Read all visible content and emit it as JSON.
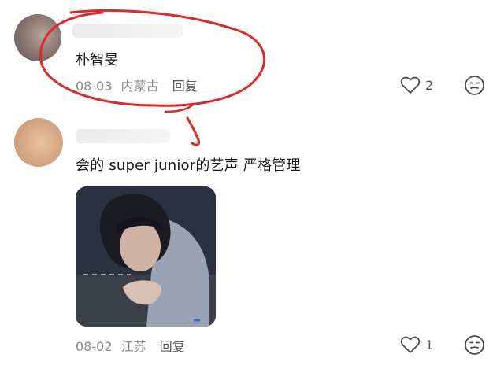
{
  "comments": [
    {
      "text": "朴智旻",
      "date": "08-03",
      "location": "内蒙古",
      "reply_label": "回复",
      "like_count": "2"
    },
    {
      "text": "会的 super junior的艺声 严格管理",
      "date": "08-02",
      "location": "江苏",
      "reply_label": "回复",
      "like_count": "1"
    }
  ],
  "icons": {
    "like": "heart-outline-icon",
    "react": "smiley-face-icon"
  },
  "colors": {
    "annotation_red": "#e0262a",
    "meta_gray": "#8a8a8a"
  }
}
